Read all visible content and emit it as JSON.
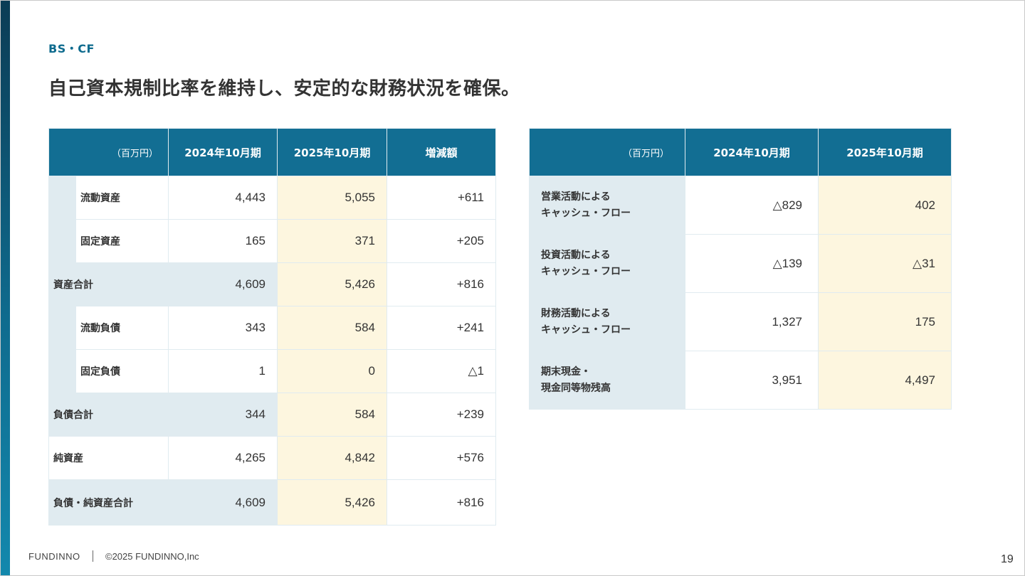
{
  "header": {
    "section": "BS・CF",
    "title": "自己資本規制比率を維持し、安定的な財務状況を確保。"
  },
  "bs_table": {
    "headers": [
      "（百万円）",
      "2024年10月期",
      "2025年10月期",
      "増減額"
    ],
    "rows": [
      {
        "label": "流動資産",
        "v2024": "4,443",
        "v2025": "5,055",
        "diff": "+611"
      },
      {
        "label": "固定資産",
        "v2024": "165",
        "v2025": "371",
        "diff": "+205"
      },
      {
        "label": "資産合計",
        "v2024": "4,609",
        "v2025": "5,426",
        "diff": "+816"
      },
      {
        "label": "流動負債",
        "v2024": "343",
        "v2025": "584",
        "diff": "+241"
      },
      {
        "label": "固定負債",
        "v2024": "1",
        "v2025": "0",
        "diff": "△1"
      },
      {
        "label": "負債合計",
        "v2024": "344",
        "v2025": "584",
        "diff": "+239"
      },
      {
        "label": "純資産",
        "v2024": "4,265",
        "v2025": "4,842",
        "diff": "+576"
      },
      {
        "label": "負債・純資産合計",
        "v2024": "4,609",
        "v2025": "5,426",
        "diff": "+816"
      }
    ]
  },
  "cf_table": {
    "headers": [
      "（百万円）",
      "2024年10月期",
      "2025年10月期"
    ],
    "rows": [
      {
        "label1": "営業活動による",
        "label2": "キャッシュ・フロー",
        "v2024": "△829",
        "v2025": "402"
      },
      {
        "label1": "投資活動による",
        "label2": "キャッシュ・フロー",
        "v2024": "△139",
        "v2025": "△31"
      },
      {
        "label1": "財務活動による",
        "label2": "キャッシュ・フロー",
        "v2024": "1,327",
        "v2025": "175"
      },
      {
        "label1": "期末現金・",
        "label2": "現金同等物残高",
        "v2024": "3,951",
        "v2025": "4,497"
      }
    ]
  },
  "footer": {
    "brand": "FUNDINNO",
    "copyright": "©2025 FUNDINNO,Inc",
    "page": "19"
  },
  "colors": {
    "header_bg": "#126e93",
    "label_bg": "#e0ebf0",
    "highlight_bg": "#fdf6df",
    "accent_text": "#0e6b8e"
  }
}
